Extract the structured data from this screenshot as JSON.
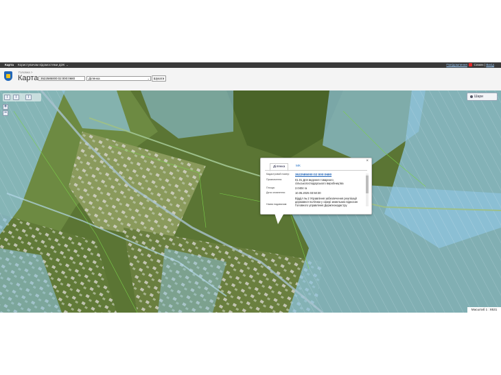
{
  "topbar": {
    "brand": "Карта",
    "menu_label": "Користувачам відомостями ДЗК",
    "notifications_link": "Повідомлення",
    "badge_count": "21",
    "user_name": "Семен",
    "separator": "|",
    "logout": "Вихід"
  },
  "header": {
    "breadcrumb": "Головна >",
    "title": "Карта",
    "cadastral_input_value": "3522585000:02:000:0680",
    "type_select_value": "Ділянка",
    "search_button": "Шукати"
  },
  "map": {
    "tool_labels": [
      "I",
      "I",
      "I"
    ],
    "zoom_in": "+",
    "zoom_out": "−",
    "layers_button": "Шари",
    "scale_text": "Масштаб 1 : 8531"
  },
  "popup": {
    "tabs": [
      "Ділянка",
      "МК"
    ],
    "close": "×",
    "fields": [
      {
        "label": "Кадастровий номер:",
        "value": "3522585000:02:000:0680"
      },
      {
        "label": "Призначення:",
        "value": "01.01 Для ведення товарного сільськогосподарського виробництва"
      },
      {
        "label": "Площа:",
        "value": "2.0404 га"
      },
      {
        "label": "Дата оновлення:",
        "value": "10.05.2025 03:50:30"
      },
      {
        "label": "Назва надавачам:",
        "value": "Відділ № 2 Управління забезпечення реалізації державної політики у сфері земельних відносин Головного управління Держгеокадастру"
      }
    ]
  }
}
